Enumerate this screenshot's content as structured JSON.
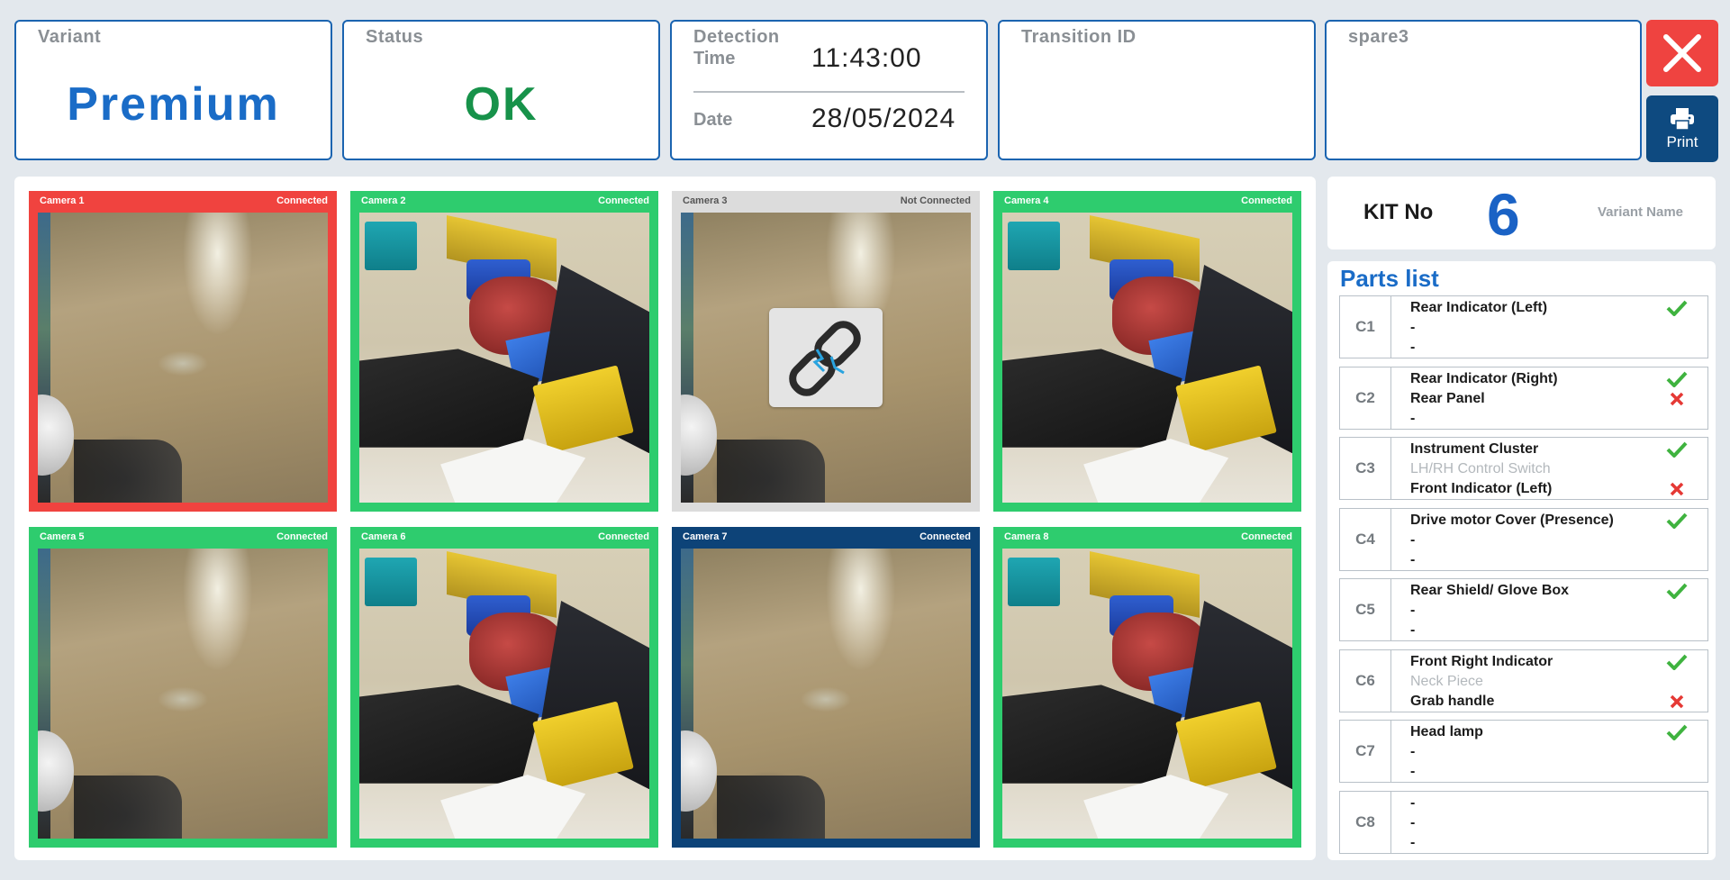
{
  "header": {
    "variant": {
      "label": "Variant",
      "value": "Premium",
      "color": "#1a6cc7"
    },
    "status": {
      "label": "Status",
      "value": "OK",
      "color": "#17924a"
    },
    "detection": {
      "title": "Detection",
      "time_label": "Time",
      "time": "11:43:00",
      "date_label": "Date",
      "date": "28/05/2024"
    },
    "transition": {
      "label": "Transition ID",
      "value": ""
    },
    "spare3": {
      "label": "spare3",
      "value": ""
    },
    "close_icon": "close-icon",
    "print": {
      "label": "Print",
      "icon": "printer-icon"
    }
  },
  "cameras": [
    {
      "name": "Camera 1",
      "status": "Connected",
      "color": "#f0433f",
      "scene": "floor"
    },
    {
      "name": "Camera 2",
      "status": "Connected",
      "color": "#2ecc6e",
      "scene": "parts"
    },
    {
      "name": "Camera 3",
      "status": "Not Connected",
      "color": "#dcdcdc",
      "scene": "floor",
      "overlay_icon": "broken-link-icon"
    },
    {
      "name": "Camera 4",
      "status": "Connected",
      "color": "#2ecc6e",
      "scene": "parts"
    },
    {
      "name": "Camera 5",
      "status": "Connected",
      "color": "#2ecc6e",
      "scene": "floor"
    },
    {
      "name": "Camera 6",
      "status": "Connected",
      "color": "#2ecc6e",
      "scene": "parts"
    },
    {
      "name": "Camera 7",
      "status": "Connected",
      "color": "#0d4378",
      "scene": "floor"
    },
    {
      "name": "Camera 8",
      "status": "Connected",
      "color": "#2ecc6e",
      "scene": "parts"
    }
  ],
  "kit": {
    "label": "KIT No",
    "number": "6",
    "variant_name_label": "Variant Name"
  },
  "parts": {
    "title": "Parts list",
    "colors": {
      "ok": "#3fb33f",
      "fail": "#e53935"
    },
    "rows": [
      {
        "code": "C1",
        "items": [
          {
            "text": "Rear Indicator (Left)",
            "state": "ok"
          },
          {
            "text": "-",
            "state": ""
          },
          {
            "text": "-",
            "state": ""
          }
        ]
      },
      {
        "code": "C2",
        "items": [
          {
            "text": "Rear Indicator (Right)",
            "state": "ok"
          },
          {
            "text": "Rear Panel",
            "state": "fail"
          },
          {
            "text": "-",
            "state": ""
          }
        ]
      },
      {
        "code": "C3",
        "items": [
          {
            "text": "Instrument Cluster",
            "state": "ok"
          },
          {
            "text": "LH/RH Control Switch",
            "state": "dim"
          },
          {
            "text": "Front Indicator (Left)",
            "state": "fail"
          }
        ]
      },
      {
        "code": "C4",
        "items": [
          {
            "text": "Drive motor Cover (Presence)",
            "state": "ok"
          },
          {
            "text": "-",
            "state": ""
          },
          {
            "text": "-",
            "state": ""
          }
        ]
      },
      {
        "code": "C5",
        "items": [
          {
            "text": "Rear Shield/ Glove Box",
            "state": "ok"
          },
          {
            "text": "-",
            "state": ""
          },
          {
            "text": "-",
            "state": ""
          }
        ]
      },
      {
        "code": "C6",
        "items": [
          {
            "text": "Front Right Indicator",
            "state": "ok"
          },
          {
            "text": "Neck Piece",
            "state": "dim"
          },
          {
            "text": "Grab handle",
            "state": "fail"
          }
        ]
      },
      {
        "code": "C7",
        "items": [
          {
            "text": "Head lamp",
            "state": "ok"
          },
          {
            "text": "-",
            "state": ""
          },
          {
            "text": "-",
            "state": ""
          }
        ]
      },
      {
        "code": "C8",
        "items": [
          {
            "text": "-",
            "state": ""
          },
          {
            "text": "-",
            "state": ""
          },
          {
            "text": "-",
            "state": ""
          }
        ]
      }
    ]
  }
}
